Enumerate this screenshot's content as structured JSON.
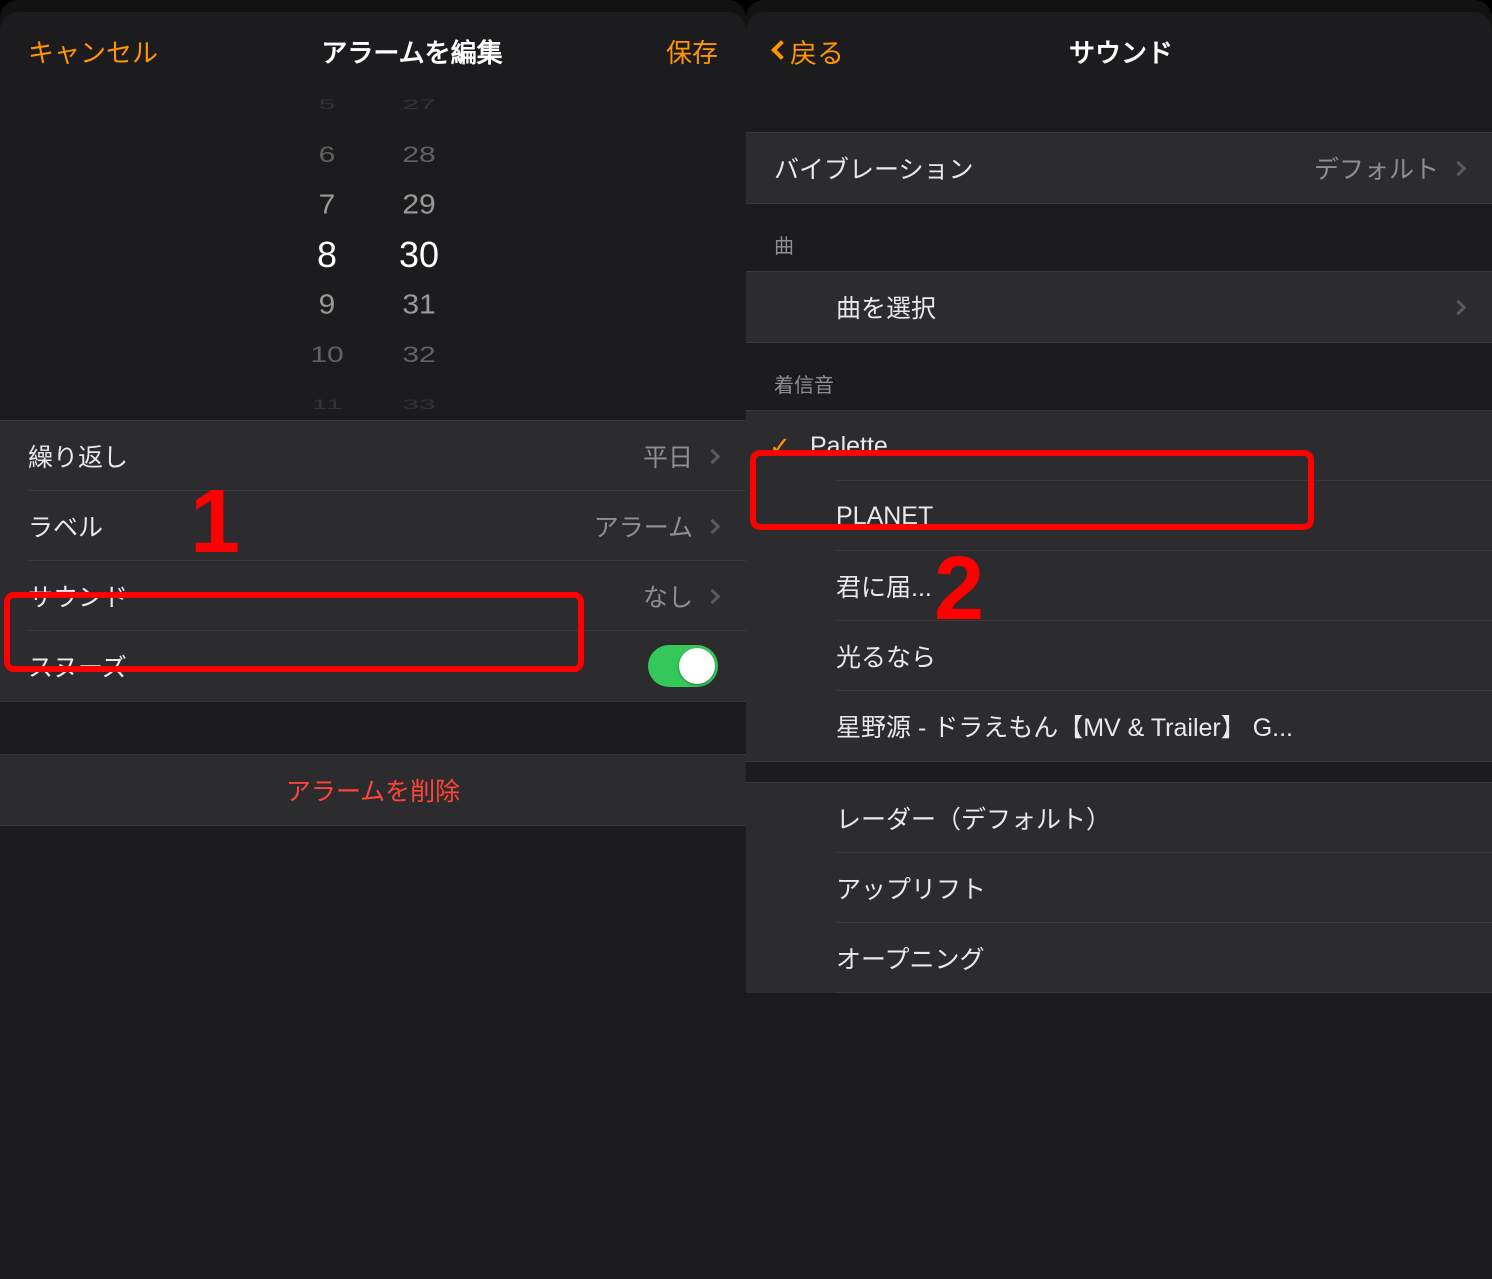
{
  "left": {
    "cancel": "キャンセル",
    "title": "アラームを編集",
    "save": "保存",
    "picker": {
      "h": [
        "5",
        "6",
        "7",
        "8",
        "9",
        "10",
        "11"
      ],
      "m": [
        "27",
        "28",
        "29",
        "30",
        "31",
        "32",
        "33"
      ]
    },
    "rows": {
      "repeat_l": "繰り返し",
      "repeat_v": "平日",
      "label_l": "ラベル",
      "label_v": "アラーム",
      "sound_l": "サウンド",
      "sound_v": "なし",
      "snooze_l": "スヌーズ"
    },
    "delete": "アラームを削除"
  },
  "right": {
    "back": "戻る",
    "title": "サウンド",
    "vib_l": "バイブレーション",
    "vib_v": "デフォルト",
    "song_h": "曲",
    "song_pick": "曲を選択",
    "ring_h": "着信音",
    "ring": [
      "Palette",
      "PLANET",
      "君に届...",
      "光るなら",
      "星野源 - ドラえもん【MV & Trailer】 G...",
      "レーダー（デフォルト）",
      "アップリフト",
      "オープニング"
    ]
  },
  "markers": {
    "one": "1",
    "two": "2"
  }
}
